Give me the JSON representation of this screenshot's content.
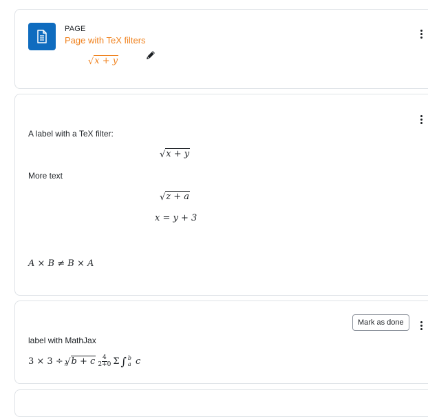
{
  "page_activity": {
    "type_label": "PAGE",
    "name": "Page with TeX filters",
    "description_math": {
      "radicand": "x + y"
    },
    "icon": "page-document-icon",
    "edit_icon": "pencil-icon",
    "menu_icon": "kebab-menu-icon"
  },
  "label_tex": {
    "text1": "A label with a TeX filter:",
    "math1": {
      "radicand": "x + y"
    },
    "text2": "More text",
    "math2": {
      "radicand": "z + a"
    },
    "math3": "x = y + 3",
    "math4": "A × B ≠ B × A",
    "menu_icon": "kebab-menu-icon"
  },
  "label_mathjax": {
    "text": "label with MathJax",
    "mark_done_label": "Mark as done",
    "math": {
      "prefix": "3 × 3 ÷",
      "root_index": "n",
      "radicand": "b + c",
      "frac_num": "4",
      "frac_den": "2+0",
      "sigma": "Σ",
      "integral": "∫",
      "int_upper": "b",
      "int_lower": "a",
      "suffix": "c"
    },
    "menu_icon": "kebab-menu-icon"
  },
  "colors": {
    "accent_orange": "#f0821e",
    "page_icon_bg": "#0f6cbf",
    "border": "#dee2e6"
  }
}
